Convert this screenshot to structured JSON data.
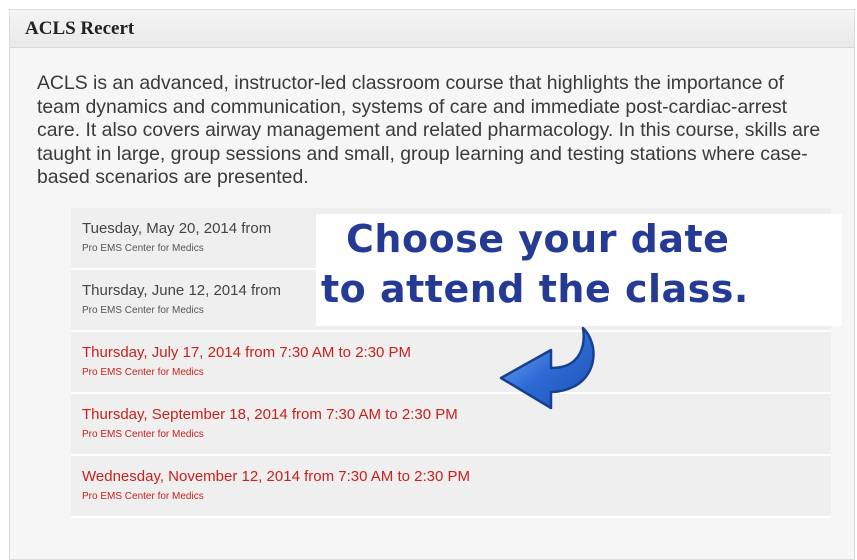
{
  "panel": {
    "title": "ACLS Recert",
    "description": "ACLS is an advanced, instructor-led classroom course that highlights the importance of team dynamics and communication, systems of care and immediate post-cardiac-arrest care. It also covers airway management and related pharmacology. In this course, skills are taught in large, group sessions and small, group learning and testing stations where case-based scenarios are presented."
  },
  "sessions": [
    {
      "date": "Tuesday, May 20, 2014 from",
      "location": "Pro EMS Center for Medics",
      "status": "unavailable"
    },
    {
      "date": "Thursday, June 12, 2014 from",
      "location": "Pro EMS Center for Medics",
      "status": "unavailable"
    },
    {
      "date": "Thursday, July 17, 2014 from 7:30 AM to 2:30 PM",
      "location": "Pro EMS Center for Medics",
      "status": "available"
    },
    {
      "date": "Thursday, September 18, 2014 from 7:30 AM to 2:30 PM",
      "location": "Pro EMS Center for Medics",
      "status": "available"
    },
    {
      "date": "Wednesday, November 12, 2014 from 7:30 AM to 2:30 PM",
      "location": "Pro EMS Center for Medics",
      "status": "available"
    }
  ],
  "callout": {
    "line1": "Choose your date",
    "line2": "to attend the class."
  },
  "colors": {
    "available": "#c8211d",
    "unavailable": "#444444",
    "callout_text": "#253a94",
    "arrow": "#2f6bd6"
  },
  "icons": {
    "pointer_arrow": "curved-arrow-icon"
  }
}
